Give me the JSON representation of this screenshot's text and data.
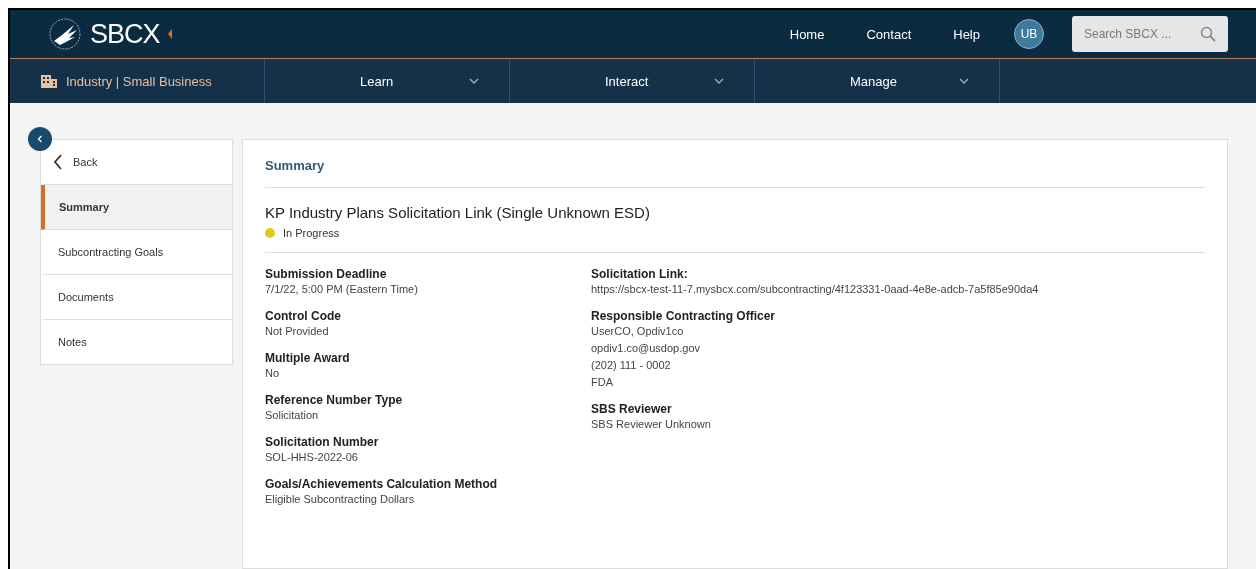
{
  "header": {
    "logo": "SBCX",
    "links": [
      "Home",
      "Contact",
      "Help"
    ],
    "avatar": "UB",
    "search": {
      "placeholder": "Search SBCX ..."
    }
  },
  "nav": {
    "section": "Industry | Small Business",
    "menus": [
      {
        "label": "Learn"
      },
      {
        "label": "Interact"
      },
      {
        "label": "Manage"
      }
    ]
  },
  "sidebar": {
    "back": "Back",
    "items": [
      {
        "label": "Summary",
        "selected": true
      },
      {
        "label": "Subcontracting Goals",
        "selected": false
      },
      {
        "label": "Documents",
        "selected": false
      },
      {
        "label": "Notes",
        "selected": false
      }
    ]
  },
  "summary": {
    "heading": "Summary",
    "title": "KP Industry Plans Solicitation Link (Single Unknown ESD)",
    "status": {
      "label": "In Progress",
      "color": "#e2c81a"
    },
    "left_fields": [
      {
        "label": "Submission Deadline",
        "lines": [
          "7/1/22, 5:00 PM (Eastern Time)"
        ]
      },
      {
        "label": "Control Code",
        "lines": [
          "Not Provided"
        ]
      },
      {
        "label": "Multiple Award",
        "lines": [
          "No"
        ]
      },
      {
        "label": "Reference Number Type",
        "lines": [
          "Solicitation"
        ]
      },
      {
        "label": "Solicitation Number",
        "lines": [
          "SOL-HHS-2022-06"
        ]
      },
      {
        "label": "Goals/Achievements Calculation Method",
        "lines": [
          "Eligible Subcontracting Dollars"
        ]
      }
    ],
    "right_fields": [
      {
        "label": "Solicitation Link:",
        "lines": [
          "https://sbcx-test-11-7.mysbcx.com/subcontracting/4f123331-0aad-4e8e-adcb-7a5f85e90da4"
        ]
      },
      {
        "label": "Responsible Contracting Officer",
        "lines": [
          "UserCO, Opdiv1co",
          "opdiv1.co@usdop.gov",
          "(202) 111 - 0002",
          "FDA"
        ]
      },
      {
        "label": "SBS Reviewer",
        "lines": [
          "SBS Reviewer Unknown"
        ]
      }
    ]
  }
}
